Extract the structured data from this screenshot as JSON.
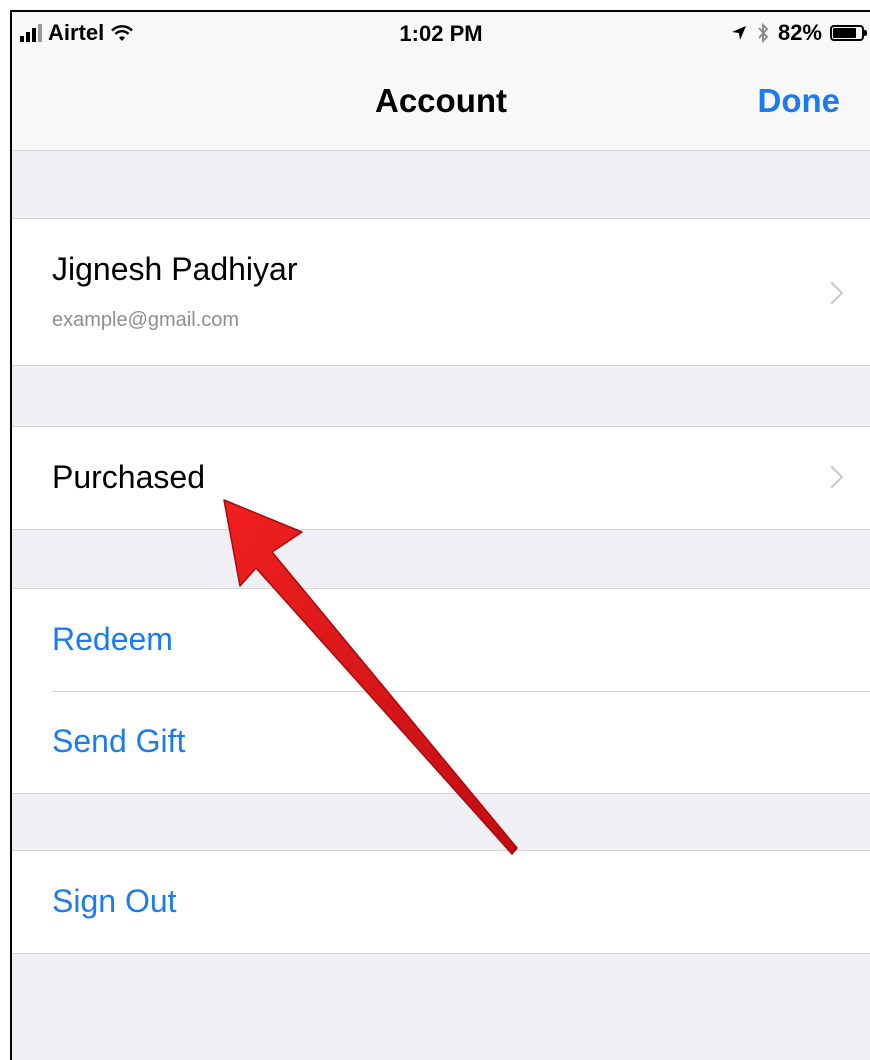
{
  "status_bar": {
    "carrier": "Airtel",
    "time": "1:02 PM",
    "battery": "82%",
    "battery_level": 0.82,
    "icons": [
      "signal-icon",
      "wifi-icon",
      "location-icon",
      "bluetooth-icon",
      "battery-icon"
    ]
  },
  "nav": {
    "title": "Account",
    "done_label": "Done"
  },
  "account": {
    "name": "Jignesh Padhiyar",
    "email": "example@gmail.com"
  },
  "items": {
    "purchased": "Purchased",
    "redeem": "Redeem",
    "send_gift": "Send Gift",
    "sign_out": "Sign Out"
  },
  "colors": {
    "accent": "#1a7cf0",
    "background": "#efeff4",
    "annotation_arrow": "#e3151a"
  }
}
